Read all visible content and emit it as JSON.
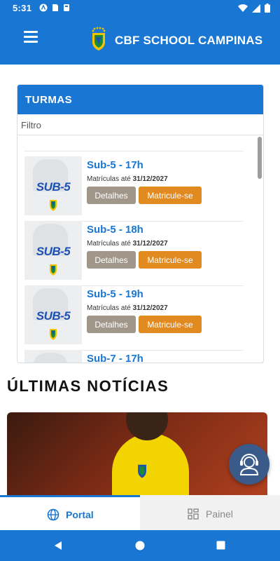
{
  "status_bar": {
    "time": "5:31"
  },
  "header": {
    "title": "CBF SCHOOL CAMPINAS",
    "crest_label": "CBF SCHOOL"
  },
  "turmas": {
    "title": "TURMAS",
    "filter_placeholder": "Filtro",
    "items": [
      {
        "name": "Sub-5 - 17h",
        "badge": "SUB-5",
        "date_prefix": "Matrículas até ",
        "date": "31/12/2027",
        "details_label": "Detalhes",
        "enroll_label": "Matricule-se"
      },
      {
        "name": "Sub-5 - 18h",
        "badge": "SUB-5",
        "date_prefix": "Matrículas até ",
        "date": "31/12/2027",
        "details_label": "Detalhes",
        "enroll_label": "Matricule-se"
      },
      {
        "name": "Sub-5 - 19h",
        "badge": "SUB-5",
        "date_prefix": "Matrículas até ",
        "date": "31/12/2027",
        "details_label": "Detalhes",
        "enroll_label": "Matricule-se"
      },
      {
        "name": "Sub-7 - 17h"
      }
    ]
  },
  "news": {
    "title": "ÚLTIMAS NOTÍCIAS"
  },
  "bottom_nav": {
    "portal_label": "Portal",
    "painel_label": "Painel"
  },
  "colors": {
    "primary": "#1976d2",
    "details_button": "#a0978a",
    "enroll_button": "#e08a20",
    "fab": "#3a5a8a"
  },
  "icons": [
    "hamburger-menu-icon",
    "cbf-crest-icon",
    "globe-icon",
    "grid-icon",
    "support-agent-icon",
    "back-icon",
    "home-icon",
    "recents-icon"
  ]
}
